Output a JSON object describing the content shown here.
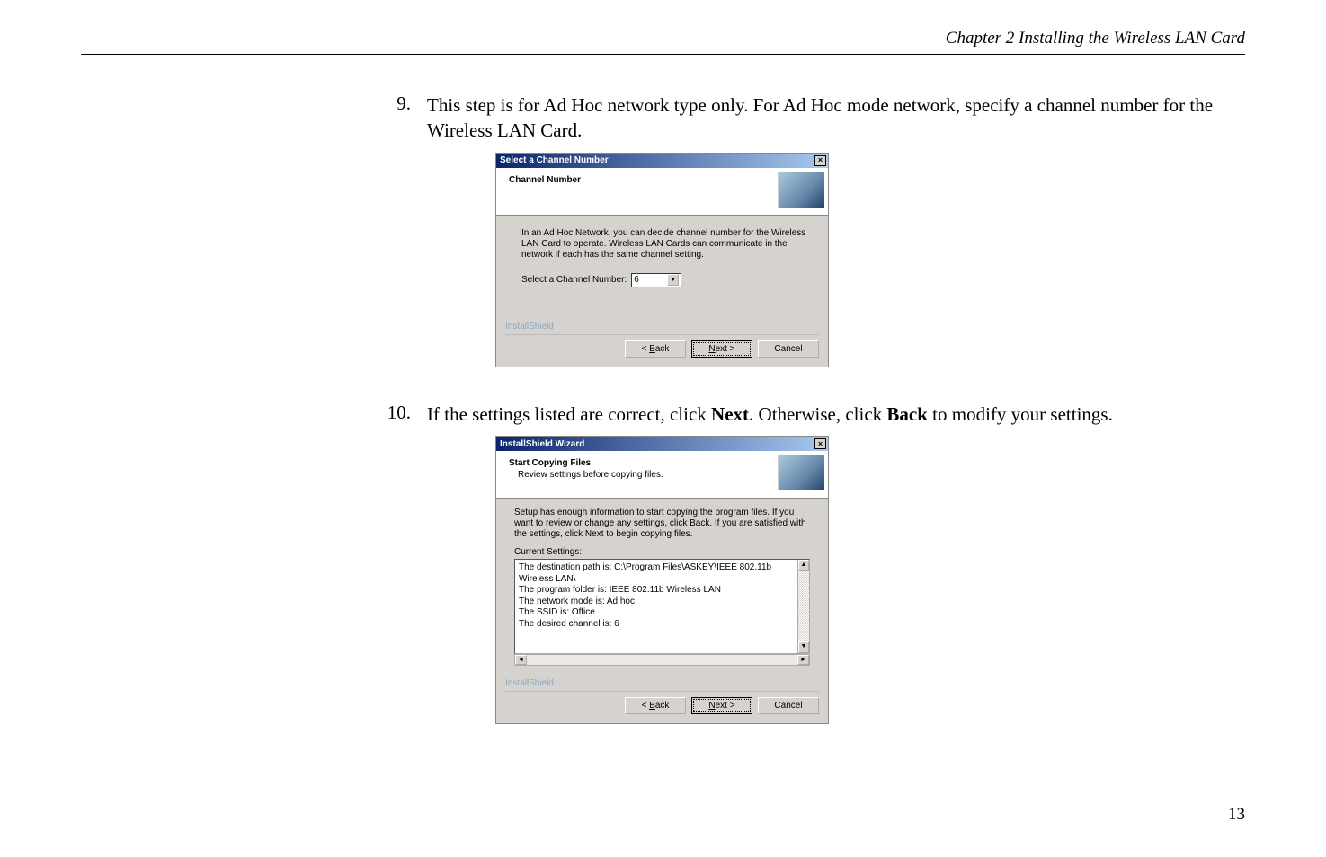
{
  "page": {
    "header": "Chapter 2    Installing the Wireless LAN Card",
    "number": "13"
  },
  "step9": {
    "num": "9.",
    "text_a": "This step is for Ad Hoc network type only. For Ad Hoc mode network, specify a channel number for the Wireless LAN Card."
  },
  "step10": {
    "num": "10.",
    "text_a": "If the settings listed are correct, click ",
    "bold_next": "Next",
    "text_b": ". Otherwise, click ",
    "bold_back": "Back",
    "text_c": " to modify your settings."
  },
  "dialog1": {
    "title": "Select a Channel Number",
    "header": "Channel Number",
    "para": "In an Ad Hoc Network, you can decide channel number for the Wireless LAN Card to operate. Wireless LAN Cards can communicate in the network if each has the same channel setting.",
    "field_label": "Select a Channel Number:",
    "field_value": "6",
    "brand": "InstallShield",
    "btn_back_u": "B",
    "btn_back": "ack",
    "btn_next_u": "N",
    "btn_next": "ext >",
    "btn_back_prefix": "< ",
    "btn_cancel": "Cancel"
  },
  "dialog2": {
    "title": "InstallShield Wizard",
    "header": "Start Copying Files",
    "sub": "Review settings before copying files.",
    "para": "Setup has enough information to start copying the program files. If you want to review or change any settings, click Back. If you are satisfied with the settings, click Next to begin copying files.",
    "cs_label": "Current Settings:",
    "line1": "The destination path is: C:\\Program Files\\ASKEY\\IEEE 802.11b Wireless LAN\\",
    "line2": "The program folder is: IEEE 802.11b Wireless LAN",
    "line3": "The network mode is: Ad hoc",
    "line4": "The SSID is:  Office",
    "line5": "The desired channel is:  6",
    "brand": "InstallShield",
    "btn_back_prefix": "< ",
    "btn_back_u": "B",
    "btn_back": "ack",
    "btn_next_u": "N",
    "btn_next": "ext >",
    "btn_cancel": "Cancel"
  }
}
